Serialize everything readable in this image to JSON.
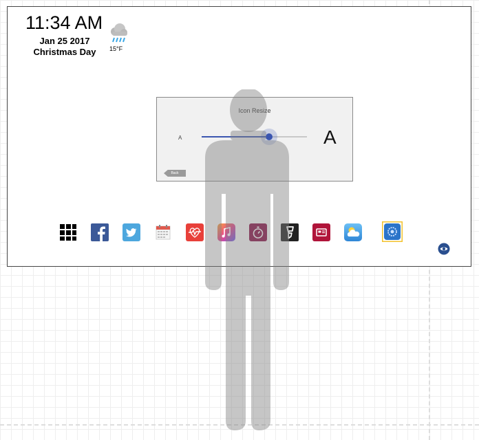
{
  "clock": {
    "time": "11:34 AM",
    "date": "Jan 25 2017",
    "holiday": "Christmas Day"
  },
  "weather": {
    "icon": "rain-cloud-icon",
    "temperature": "15°F"
  },
  "dialog": {
    "title": "Icon Resize",
    "small_label": "A",
    "large_label": "A",
    "slider_value_percent": 64,
    "back_label": "Back"
  },
  "dock": {
    "apps": [
      {
        "name": "apps-grid-icon",
        "color": "#000000"
      },
      {
        "name": "facebook-icon",
        "color": "#3b5998"
      },
      {
        "name": "twitter-icon",
        "color": "#4da7de"
      },
      {
        "name": "calendar-icon",
        "color": "#e05a4e"
      },
      {
        "name": "health-icon",
        "color": "#e8403a"
      },
      {
        "name": "music-icon",
        "color": "#c44ec0"
      },
      {
        "name": "timer-icon",
        "color": "#8a1048"
      },
      {
        "name": "foursquare-icon",
        "color": "#222222"
      },
      {
        "name": "news-icon",
        "color": "#b0143a"
      },
      {
        "name": "weather-icon",
        "color": "#4ea3e0"
      },
      {
        "name": "settings-icon",
        "color": "#2b74c9"
      }
    ],
    "selected_app": "settings-icon"
  },
  "accessibility": {
    "icon": "eye-icon",
    "color": "#2a4f8f"
  }
}
